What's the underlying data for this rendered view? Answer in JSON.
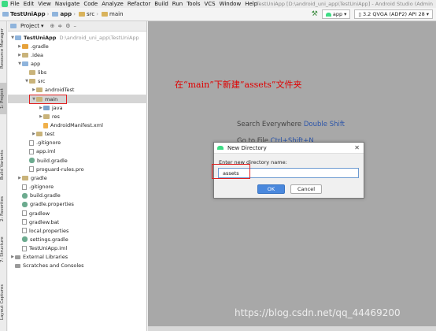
{
  "menubar": {
    "items": [
      "File",
      "Edit",
      "View",
      "Navigate",
      "Code",
      "Analyze",
      "Refactor",
      "Build",
      "Run",
      "Tools",
      "VCS",
      "Window",
      "Help"
    ],
    "window_title": "TestUniApp [D:\\android_uni_app\\TestUniApp] - Android Studio (Admin"
  },
  "breadcrumb": {
    "items": [
      "TestUniApp",
      "app",
      "src",
      "main"
    ]
  },
  "toolbar": {
    "run_config": "app",
    "device": "3.2  QVGA (ADP2) API 28"
  },
  "left_strip": {
    "tabs": [
      "Resource Manager",
      "1: Project",
      "Build Variants",
      "2: Favorites",
      "7: Structure",
      "Layout Captures"
    ]
  },
  "project_panel": {
    "title": "Project",
    "tree": [
      {
        "label": "TestUniApp",
        "path": "D:\\android_uni_app\\TestUniApp",
        "depth": 0,
        "icon": "module-folder",
        "expanded": true
      },
      {
        "label": ".gradle",
        "depth": 1,
        "icon": "orange-folder",
        "expanded": false
      },
      {
        "label": ".idea",
        "depth": 1,
        "icon": "folder",
        "expanded": false
      },
      {
        "label": "app",
        "depth": 1,
        "icon": "module-folder",
        "expanded": true
      },
      {
        "label": "libs",
        "depth": 2,
        "icon": "folder",
        "expanded": null
      },
      {
        "label": "src",
        "depth": 2,
        "icon": "folder",
        "expanded": true
      },
      {
        "label": "androidTest",
        "depth": 3,
        "icon": "folder",
        "expanded": false
      },
      {
        "label": "main",
        "depth": 3,
        "icon": "folder",
        "expanded": true,
        "selected": true
      },
      {
        "label": "java",
        "depth": 4,
        "icon": "source-folder",
        "expanded": false
      },
      {
        "label": "res",
        "depth": 4,
        "icon": "resource-folder",
        "expanded": false
      },
      {
        "label": "AndroidManifest.xml",
        "depth": 4,
        "icon": "xml-file",
        "expanded": null
      },
      {
        "label": "test",
        "depth": 3,
        "icon": "folder",
        "expanded": false
      },
      {
        "label": ".gitignore",
        "depth": 2,
        "icon": "file",
        "expanded": null
      },
      {
        "label": "app.iml",
        "depth": 2,
        "icon": "file",
        "expanded": null
      },
      {
        "label": "build.gradle",
        "depth": 2,
        "icon": "gradle-file",
        "expanded": null
      },
      {
        "label": "proguard-rules.pro",
        "depth": 2,
        "icon": "file",
        "expanded": null
      },
      {
        "label": "gradle",
        "depth": 1,
        "icon": "folder",
        "expanded": false
      },
      {
        "label": ".gitignore",
        "depth": 1,
        "icon": "file",
        "expanded": null
      },
      {
        "label": "build.gradle",
        "depth": 1,
        "icon": "gradle-file",
        "expanded": null
      },
      {
        "label": "gradle.properties",
        "depth": 1,
        "icon": "gradle-file",
        "expanded": null
      },
      {
        "label": "gradlew",
        "depth": 1,
        "icon": "file",
        "expanded": null
      },
      {
        "label": "gradlew.bat",
        "depth": 1,
        "icon": "file",
        "expanded": null
      },
      {
        "label": "local.properties",
        "depth": 1,
        "icon": "file",
        "expanded": null
      },
      {
        "label": "settings.gradle",
        "depth": 1,
        "icon": "gradle-file",
        "expanded": null
      },
      {
        "label": "TestUniApp.iml",
        "depth": 1,
        "icon": "file",
        "expanded": null
      },
      {
        "label": "External Libraries",
        "depth": 0,
        "icon": "library",
        "expanded": false
      },
      {
        "label": "Scratches and Consoles",
        "depth": 0,
        "icon": "scratches",
        "expanded": null
      }
    ]
  },
  "editor": {
    "annotation": "在“main”下新建”assets”文件夹",
    "hint_search": "Search Everywhere",
    "hint_search_key": "Double Shift",
    "hint_goto": "Go to File",
    "hint_goto_key": "Ctrl+Shift+N"
  },
  "dialog": {
    "title": "New Directory",
    "label": "Enter new directory name:",
    "input_value": "assets",
    "ok_label": "OK",
    "cancel_label": "Cancel"
  },
  "watermark": "https://blog.csdn.net/qq_44469200"
}
